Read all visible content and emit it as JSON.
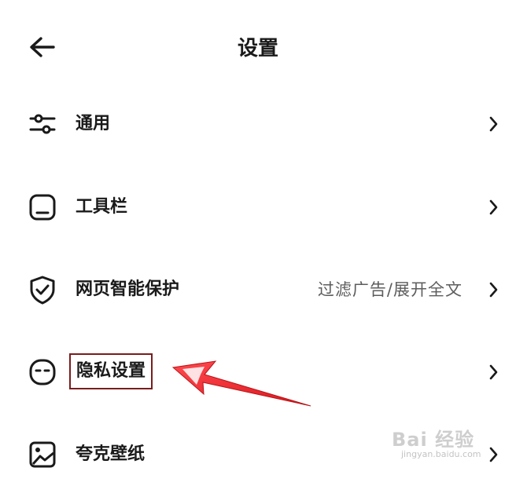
{
  "header": {
    "back_icon": "arrow-left-icon",
    "title": "设置"
  },
  "rows": [
    {
      "icon": "sliders-icon",
      "label": "通用",
      "value": "",
      "chevron": "chevron-right-icon"
    },
    {
      "icon": "toolbar-icon",
      "label": "工具栏",
      "value": "",
      "chevron": "chevron-right-icon"
    },
    {
      "icon": "shield-check-icon",
      "label": "网页智能保护",
      "value": "过滤广告/展开全文",
      "chevron": "chevron-right-icon"
    },
    {
      "icon": "incognito-face-icon",
      "label": "隐私设置",
      "value": "",
      "chevron": "chevron-right-icon",
      "highlighted": true
    },
    {
      "icon": "wallpaper-image-icon",
      "label": "夸克壁纸",
      "value": "",
      "chevron": "chevron-right-icon"
    }
  ],
  "annotation": {
    "arrow_color": "#e8222a",
    "box_color": "#7a1c1c"
  },
  "watermark": {
    "logo": "Bai 经验",
    "url": "jingyan.baidu.com"
  },
  "colors": {
    "text": "#1a1a1a",
    "secondary_text": "#5d5d5d",
    "background": "#ffffff"
  }
}
